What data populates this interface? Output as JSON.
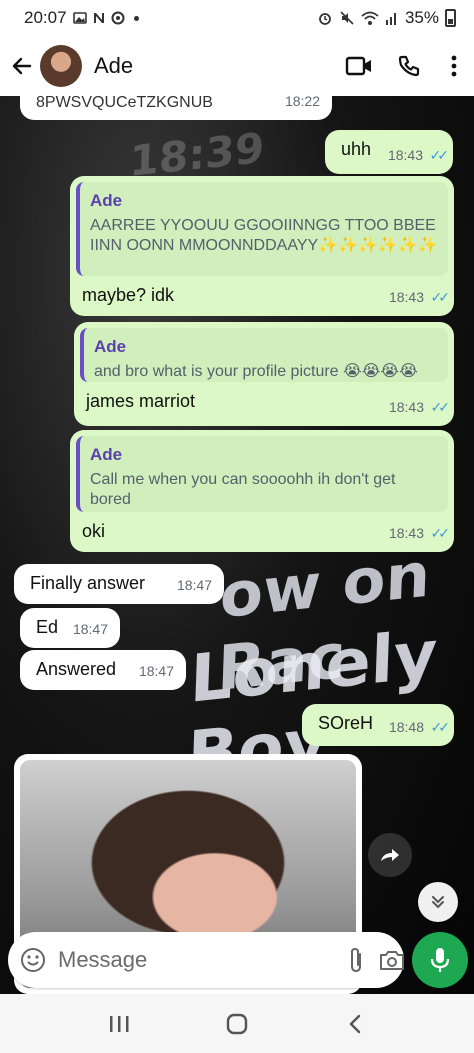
{
  "status_bar": {
    "time": "20:07",
    "battery": "35%",
    "icons_left": [
      "image-icon",
      "n-icon",
      "vpn-icon",
      "dot"
    ],
    "icons_right": [
      "alarm-icon",
      "mute-icon",
      "wifi-icon",
      "signal-icon",
      "battery-icon"
    ]
  },
  "header": {
    "contact_name": "Ade",
    "back_icon": "arrow-left-icon",
    "video_icon": "video-camera-icon",
    "call_icon": "phone-icon",
    "menu_icon": "kebab-menu-icon"
  },
  "messages": [
    {
      "id": "m0",
      "direction": "in",
      "text": "8PWSVQUCeTZKGNUB",
      "time": "18:22"
    },
    {
      "id": "m1",
      "direction": "out",
      "text": "uhh",
      "time": "18:43",
      "status": "read"
    },
    {
      "id": "m2",
      "direction": "out",
      "quote_author": "Ade",
      "quote_text": "AARREE YYOOUU GGOOIINNGG TTOO BBEE IINN OONN MMOONNDDAAYY✨✨✨✨✨✨",
      "text": "maybe? idk",
      "time": "18:43",
      "status": "read"
    },
    {
      "id": "m3",
      "direction": "out",
      "quote_author": "Ade",
      "quote_text": "and bro what is your profile picture 😭😭😭😭",
      "text": "james marriot",
      "time": "18:43",
      "status": "read"
    },
    {
      "id": "m4",
      "direction": "out",
      "quote_author": "Ade",
      "quote_text": "Call me when you can soooohh ih don't get bored",
      "text": "oki",
      "time": "18:43",
      "status": "read"
    },
    {
      "id": "m5",
      "direction": "in",
      "text": "Finally answer",
      "time": "18:47"
    },
    {
      "id": "m6",
      "direction": "in",
      "text": "Ed",
      "time": "18:47"
    },
    {
      "id": "m7",
      "direction": "in",
      "text": "Answered",
      "time": "18:47"
    },
    {
      "id": "m8",
      "direction": "out",
      "text": "SOreH",
      "time": "18:48",
      "status": "read"
    }
  ],
  "wallpaper_text": [
    "18:39",
    "ow on Rac",
    "Lonely Boy"
  ],
  "ticks": "✓✓",
  "photo_message": {
    "type": "image"
  },
  "input": {
    "placeholder": "Message"
  },
  "colors": {
    "outgoing_bubble": "#dcf8c6",
    "incoming_bubble": "#ffffff",
    "read_ticks": "#3a9ae0",
    "quote_bar": "#6a4fc4",
    "mic_button": "#1da851"
  },
  "nav_bar": {
    "icons": [
      "recents-icon",
      "home-icon",
      "back-icon"
    ]
  }
}
